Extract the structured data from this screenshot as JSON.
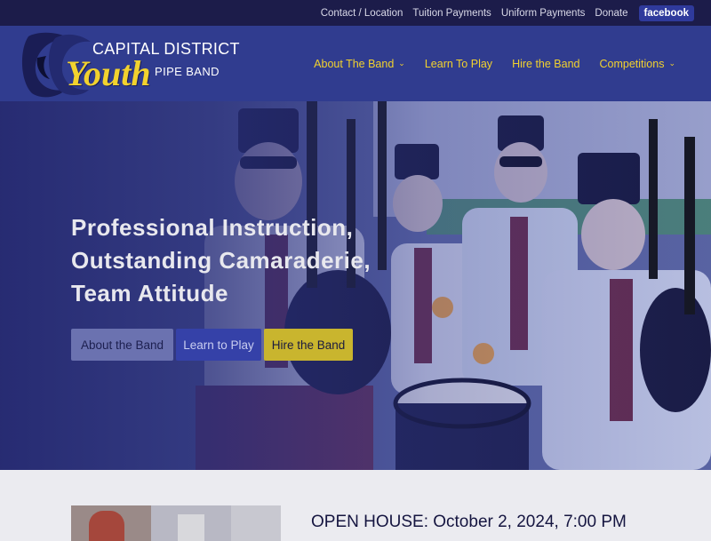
{
  "topbar": {
    "links": [
      "Contact / Location",
      "Tuition Payments",
      "Uniform Payments",
      "Donate"
    ],
    "facebook": "facebook"
  },
  "logo": {
    "line1": "CAPITAL DISTRICT",
    "line2": "Youth",
    "line3": "PIPE BAND"
  },
  "nav": {
    "items": [
      {
        "label": "About The Band",
        "has_dropdown": true
      },
      {
        "label": "Learn To Play",
        "has_dropdown": false
      },
      {
        "label": "Hire the Band",
        "has_dropdown": false
      },
      {
        "label": "Competitions",
        "has_dropdown": true
      }
    ]
  },
  "hero": {
    "headline_lines": [
      "Professional Instruction,",
      "Outstanding Camaraderie,",
      "Team Attitude"
    ],
    "buttons": {
      "about": "About the Band",
      "learn": "Learn to Play",
      "hire": "Hire the Band"
    }
  },
  "event": {
    "title": "OPEN HOUSE: October 2, 2024, 7:00 PM"
  },
  "colors": {
    "topbar_bg": "#1c1c4a",
    "header_bg": "#303c8f",
    "accent_yellow": "#f2d22e",
    "facebook_bg": "#2f3a9c"
  }
}
